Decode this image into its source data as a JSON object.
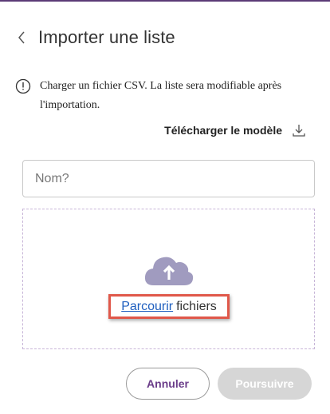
{
  "header": {
    "title": "Importer une liste",
    "back_icon": "chevron-left-icon"
  },
  "info": {
    "icon": "info-circle-icon",
    "text": "Charger un fichier CSV. La liste sera modifiable après l'importation."
  },
  "download": {
    "label": "Télécharger le modèle",
    "icon": "download-icon"
  },
  "name_field": {
    "placeholder": "Nom?",
    "value": ""
  },
  "dropzone": {
    "icon": "cloud-upload-icon",
    "browse_link": "Parcourir",
    "browse_rest": "fichiers"
  },
  "actions": {
    "cancel_label": "Annuler",
    "continue_label": "Poursuivre"
  },
  "colors": {
    "accent": "#5b3a76",
    "cancel_text": "#6b3d8a",
    "link": "#1f5fbf",
    "highlight": "#e0584a",
    "cloud": "#a09bbf",
    "disabled": "#d6d6d6"
  }
}
